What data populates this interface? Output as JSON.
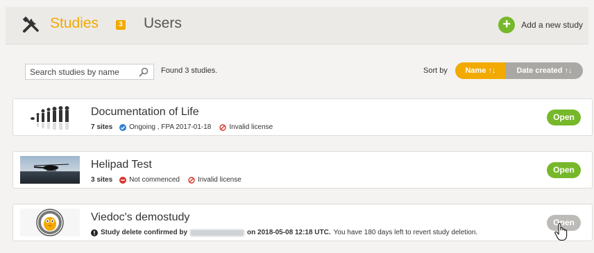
{
  "header": {
    "studies_label": "Studies",
    "studies_count": "3",
    "users_label": "Users",
    "add_study_label": "Add a new study"
  },
  "toolbar": {
    "search_placeholder": "Search studies by name",
    "found_text": "Found 3 studies.",
    "sort_label": "Sort by",
    "sort_name_label": "Name ↑↓",
    "sort_date_label": "Date created ↑↓"
  },
  "colors": {
    "accent": "#f2a900",
    "open_green": "#76b82a",
    "status_ongoing": "#2d7fd3",
    "status_invalid": "#d9342b"
  },
  "studies": [
    {
      "title": "Documentation of Life",
      "sites": "7 sites",
      "status_icon": "check-circle-icon",
      "status": "Ongoing , FPA 2017-01-18",
      "license_icon": "forbidden-icon",
      "license": "Invalid license",
      "open_label": "Open"
    },
    {
      "title": "Helipad Test",
      "sites": "3 sites",
      "status_icon": "minus-circle-icon",
      "status": "Not commenced",
      "license_icon": "forbidden-icon",
      "license": "Invalid license",
      "open_label": "Open"
    },
    {
      "title": "Viedoc's demostudy",
      "notice_icon": "info-circle-icon",
      "notice_prefix": "Study delete confirmed by",
      "notice_date": "on 2018-05-08 12:18 UTC.",
      "notice_suffix": "You have 180 days left to revert study deletion.",
      "open_label": "Open"
    }
  ]
}
